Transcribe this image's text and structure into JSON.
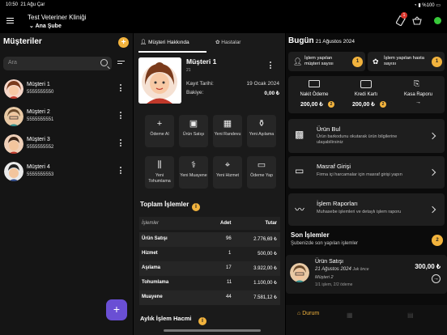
{
  "status": {
    "time": "10:50",
    "date": "21 Ağu Çar",
    "battery": "%100"
  },
  "header": {
    "clinic": "Test Veteriner Kliniği",
    "branch": "Ana Şube",
    "cart_badge": "1"
  },
  "customers": {
    "title": "Müşteriler",
    "search_placeholder": "Ara",
    "items": [
      {
        "name": "Müşteri 1",
        "phone": "5555555550"
      },
      {
        "name": "Müşteri 2",
        "phone": "5555555551"
      },
      {
        "name": "Müşteri 3",
        "phone": "5555555552"
      },
      {
        "name": "Müşteri 4",
        "phone": "5555555553"
      }
    ]
  },
  "detail": {
    "tabs": [
      "Müşteri Hakkında",
      "Hastalar"
    ],
    "name": "Müşteri 1",
    "id": "21",
    "reg_label": "Kayıt Tarihi:",
    "reg_value": "19 Ocak 2024",
    "bal_label": "Bakiye:",
    "bal_value": "0,00 ₺",
    "actions": [
      {
        "label": "Ödeme Al",
        "icon": "plus-icon"
      },
      {
        "label": "Ürün Satışı",
        "icon": "box-icon"
      },
      {
        "label": "Yeni Randevu",
        "icon": "calendar-icon"
      },
      {
        "label": "Yeni Aşılama",
        "icon": "syringe-icon"
      },
      {
        "label": "Yeni Tohumlama",
        "icon": "vials-icon"
      },
      {
        "label": "Yeni Muayene",
        "icon": "stethoscope-icon"
      },
      {
        "label": "Yeni Hizmet",
        "icon": "pin-icon"
      },
      {
        "label": "Ödeme Yap",
        "icon": "cash-icon"
      }
    ],
    "totals_title": "Toplam İşlemler",
    "table_headers": [
      "İşlemler",
      "Adet",
      "Tutar"
    ],
    "rows": [
      {
        "name": "Ürün Satışı",
        "qty": "96",
        "total": "2.776,69 ₺"
      },
      {
        "name": "Hizmet",
        "qty": "1",
        "total": "500,00 ₺"
      },
      {
        "name": "Aşılama",
        "qty": "17",
        "total": "3.922,00 ₺"
      },
      {
        "name": "Tohumlama",
        "qty": "11",
        "total": "1.100,00 ₺"
      },
      {
        "name": "Muayene",
        "qty": "44",
        "total": "7.581,12 ₺"
      }
    ],
    "monthly_title": "Aylık İşlem Hacmi"
  },
  "today": {
    "title": "Bugün",
    "date": "21 Ağustos 2024",
    "customer_label": "İşlem yapılan müşteri sayısı",
    "customer_count": "1",
    "patient_label": "İşlem yapılan hasta sayısı",
    "patient_count": "1",
    "cash_label": "Nakit Ödeme",
    "cash_value": "200,00 ₺",
    "cash_count": "2",
    "card_label": "Kredi Kartı",
    "card_value": "200,00 ₺",
    "card_count": "2",
    "report_label": "Kasa Raporu",
    "menu": [
      {
        "title": "Ürün Bul",
        "desc": "Ürün barkodunu okutarak ürün bilgilerine ulaşabilirsiniz"
      },
      {
        "title": "Masraf Girişi",
        "desc": "Firma içi harcamalar için masraf girişi yapın"
      },
      {
        "title": "İşlem Raporları",
        "desc": "Muhasebe işlemleri ve detaylı işlem raporu"
      }
    ],
    "recent_title": "Son İşlemler",
    "recent_sub": "Şubenizde son yapılan işlemler",
    "recent_count": "2",
    "recent": {
      "title": "Ürün Satışı",
      "date": "21 Ağustos 2024",
      "ago": "Jak önce",
      "customer": "Müşteri 2",
      "meta": "1/1 işlem, 2/2 ödeme",
      "amount": "300,00 ₺"
    },
    "bottom_nav": "Durum"
  }
}
